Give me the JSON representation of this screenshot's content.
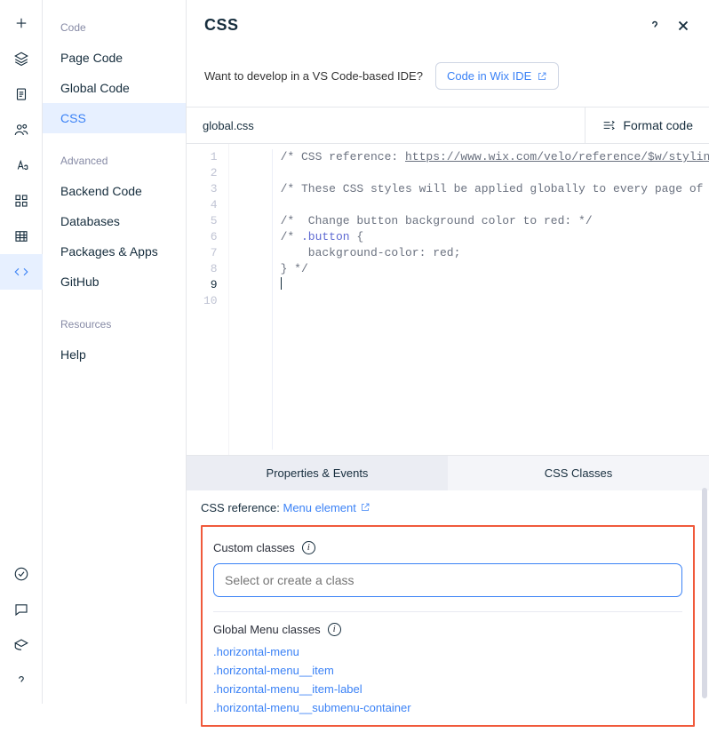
{
  "rail": {
    "icons": [
      "plus",
      "layers",
      "page",
      "people",
      "text",
      "grid",
      "table",
      "braces"
    ],
    "bottom_icons": [
      "check-circle",
      "chat",
      "education",
      "help"
    ]
  },
  "sidebar": {
    "sections": [
      {
        "heading": "Code",
        "items": [
          "Page Code",
          "Global Code",
          "CSS"
        ],
        "selected": 2
      },
      {
        "heading": "Advanced",
        "items": [
          "Backend Code",
          "Databases",
          "Packages & Apps",
          "GitHub"
        ]
      },
      {
        "heading": "Resources",
        "items": [
          "Help"
        ]
      }
    ]
  },
  "header": {
    "title": "CSS"
  },
  "ide_prompt": {
    "text": "Want to develop in a VS Code-based IDE?",
    "button": "Code in Wix IDE"
  },
  "filebar": {
    "filename": "global.css",
    "format_label": "Format code"
  },
  "editor": {
    "lines": [
      "/* CSS reference: https://www.wix.com/velo/reference/$w/styling-elem",
      "",
      "/* These CSS styles will be applied globally to every page of this s",
      "",
      "/*  Change button background color to red: */",
      "/* .button {",
      "    background-color: red;",
      "} */",
      "",
      ""
    ],
    "current_line": 9
  },
  "panel": {
    "tabs": [
      "Properties & Events",
      "CSS Classes"
    ],
    "active_tab": 0,
    "reference_label": "CSS reference:",
    "reference_link": "Menu element",
    "custom_label": "Custom classes",
    "custom_placeholder": "Select or create a class",
    "global_label": "Global Menu classes",
    "global_classes": [
      ".horizontal-menu",
      ".horizontal-menu__item",
      ".horizontal-menu__item-label",
      ".horizontal-menu__submenu-container"
    ]
  }
}
